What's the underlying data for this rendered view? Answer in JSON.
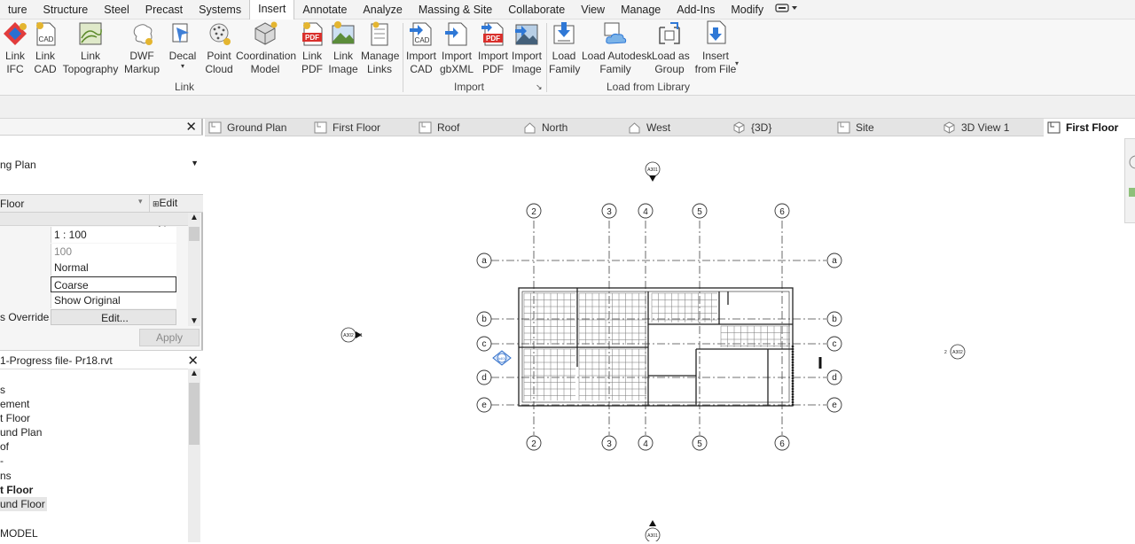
{
  "menu": {
    "tabs": [
      "ture",
      "Structure",
      "Steel",
      "Precast",
      "Systems",
      "Insert",
      "Annotate",
      "Analyze",
      "Massing & Site",
      "Collaborate",
      "View",
      "Manage",
      "Add-Ins",
      "Modify"
    ],
    "active": "Insert"
  },
  "ribbon": {
    "buttons": {
      "link_ifc": "Link\nIFC",
      "link_cad": "Link\nCAD",
      "link_topography": "Link\nTopography",
      "dwf_markup": "DWF\nMarkup",
      "decal": "Decal",
      "point_cloud": "Point\nCloud",
      "coordination_model": "Coordination\nModel",
      "link_pdf": "Link\nPDF",
      "link_image": "Link\nImage",
      "manage_links": "Manage\nLinks",
      "import_cad": "Import\nCAD",
      "import_gbxml": "Import\ngbXML",
      "import_pdf": "Import\nPDF",
      "import_image": "Import\nImage",
      "load_family": "Load\nFamily",
      "load_autodesk_family": "Load Autodesk\nFamily",
      "load_as_group": "Load as\nGroup",
      "insert_from_file": "Insert\nfrom File"
    },
    "groups": {
      "link": "Link",
      "import": "Import",
      "load_from_library": "Load from Library"
    },
    "icon_text": {
      "cad": "CAD",
      "pdf": "PDF"
    }
  },
  "properties": {
    "type_name": "ng Plan",
    "level": "Floor",
    "edit_type": "Edit Type",
    "rows": [
      {
        "key": "",
        "value": "1 : 100"
      },
      {
        "key": "",
        "value": "100"
      },
      {
        "key": "",
        "value": "Normal"
      },
      {
        "key": "",
        "value": "Coarse"
      },
      {
        "key": "",
        "value": "Show Original"
      },
      {
        "key": "s Overrides",
        "value": "Edit..."
      }
    ],
    "apply": "Apply"
  },
  "project_browser": {
    "title": "1-Progress file- Pr18.rvt",
    "items": [
      "s",
      "ement",
      "t Floor",
      "und Plan",
      "of",
      "-",
      "ns",
      "t Floor",
      "und Floor",
      "",
      "MODEL"
    ]
  },
  "view_tabs": [
    {
      "label": "Ground Plan",
      "icon": "floor-plan-icon"
    },
    {
      "label": "First Floor",
      "icon": "floor-plan-icon"
    },
    {
      "label": "Roof",
      "icon": "floor-plan-icon"
    },
    {
      "label": "North",
      "icon": "elevation-icon"
    },
    {
      "label": "West",
      "icon": "elevation-icon"
    },
    {
      "label": "{3D}",
      "icon": "3d-view-icon"
    },
    {
      "label": "Site",
      "icon": "floor-plan-icon"
    },
    {
      "label": "3D View 1",
      "icon": "3d-view-icon"
    },
    {
      "label": "First Floor",
      "icon": "floor-plan-icon"
    }
  ],
  "drawing": {
    "grid_numbers": [
      "2",
      "3",
      "4",
      "5",
      "6"
    ],
    "grid_letters": [
      "a",
      "b",
      "c",
      "d",
      "e"
    ],
    "section_tags": {
      "top": "A301",
      "bottom": "A301",
      "left": "A302",
      "right": "A302",
      "elev_num_1": "1",
      "elev_num_2": "2",
      "elev_sheet": "A401"
    }
  }
}
